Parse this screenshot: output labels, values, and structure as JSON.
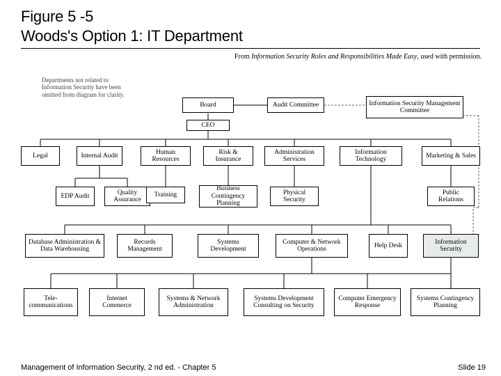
{
  "title": {
    "line1": "Figure 5 -5",
    "line2": "Woods's Option 1: IT Department"
  },
  "attribution": {
    "prefix": "From ",
    "source": "Information Security Roles and Responsibilities Made Easy",
    "suffix": ", used with permission."
  },
  "note": "Departments not related to Information Security have been omitted from diagram for clarity.",
  "nodes": {
    "board": "Board",
    "audit_committee": "Audit Committee",
    "ismc": "Information Security Management Committee",
    "ceo": "CEO",
    "legal": "Legal",
    "internal_audit": "Internal Audit",
    "hr": "Human Resources",
    "risk_ins": "Risk & Insurance",
    "admin_svc": "Administration Services",
    "it": "Information Technology",
    "mkt_sales": "Marketing & Sales",
    "edp_audit": "EDP Audit",
    "qa": "Quality Assurance",
    "training": "Training",
    "bcp": "Business Contingency Planning",
    "phys_sec": "Physical Security",
    "pr": "Public Relations",
    "dba": "Database Administration & Data Warehousing",
    "records": "Records Management",
    "sys_dev": "Systems Development",
    "cno": "Computer & Network Operations",
    "help_desk": "Help Desk",
    "infosec": "Information Security",
    "telecom": "Tele- communications",
    "icom": "Internet Commerce",
    "sna": "Systems & Network Administration",
    "sdcs": "Systems Development Consulting on Security",
    "cer": "Computer Emergency Response",
    "scp": "Systems Contingency Planning"
  },
  "footer": {
    "left": "Management of Information Security, 2 nd ed. - Chapter 5",
    "right": "Slide 19"
  }
}
